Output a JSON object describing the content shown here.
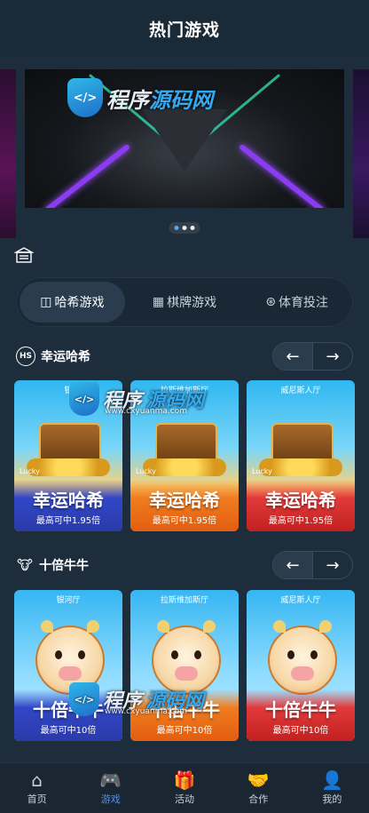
{
  "header": {
    "title": "热门游戏"
  },
  "banner": {
    "logo_text_a": "程序",
    "logo_text_b": "源码网",
    "logo_badge": "</>",
    "dot_count": 3
  },
  "icons": {
    "notice": "notice-board-icon",
    "hash_tab": "gamepad-icon",
    "chess_tab": "cards-icon",
    "sports_tab": "soccer-ball-icon",
    "left_arrow": "arrow-left-icon",
    "right_arrow": "arrow-right-icon"
  },
  "tabs": [
    {
      "label": "哈希游戏",
      "glyph": "◫",
      "active": true
    },
    {
      "label": "棋牌游戏",
      "glyph": "▦",
      "active": false
    },
    {
      "label": "体育投注",
      "glyph": "⊛",
      "active": false
    }
  ],
  "section1": {
    "badge": "HS",
    "title": "幸运哈希",
    "arrow_left": "←",
    "arrow_right": "→",
    "cards": [
      {
        "hall": "银",
        "name": "幸运哈希",
        "odds": "最高可中1.95倍",
        "lucky": "Lucky",
        "theme": "blue"
      },
      {
        "hall": "拉斯维加斯厅",
        "name": "幸运哈希",
        "odds": "最高可中1.95倍",
        "lucky": "Lucky",
        "theme": "orange"
      },
      {
        "hall": "威尼斯人厅",
        "name": "幸运哈希",
        "odds": "最高可中1.95倍",
        "lucky": "Lucky",
        "theme": "red"
      }
    ]
  },
  "section2": {
    "badge": "🐮",
    "title": "十倍牛牛",
    "arrow_left": "←",
    "arrow_right": "→",
    "cards": [
      {
        "hall": "银河厅",
        "name": "十倍牛牛",
        "odds": "最高可中10倍",
        "theme": "blue"
      },
      {
        "hall": "拉斯维加斯厅",
        "name": "十倍牛牛",
        "odds": "最高可中10倍",
        "theme": "orange"
      },
      {
        "hall": "威尼斯人厅",
        "name": "十倍牛牛",
        "odds": "最高可中10倍",
        "theme": "red"
      }
    ]
  },
  "watermark": {
    "a": "程序",
    "b": "源码网",
    "url": "www.cxyuanma.com",
    "badge": "</>"
  },
  "tabbar": [
    {
      "label": "首页",
      "glyph": "⌂",
      "icon": "home-icon",
      "active": false
    },
    {
      "label": "游戏",
      "glyph": "🎮",
      "icon": "gamepad-icon",
      "active": true
    },
    {
      "label": "活动",
      "glyph": "🎁",
      "icon": "gift-icon",
      "active": false
    },
    {
      "label": "合作",
      "glyph": "🤝",
      "icon": "handshake-icon",
      "active": false
    },
    {
      "label": "我的",
      "glyph": "👤",
      "icon": "user-icon",
      "active": false
    }
  ],
  "colors": {
    "background": "#1e2d3b",
    "accent": "#4b8ef5",
    "watermark": "#35a9f0"
  }
}
